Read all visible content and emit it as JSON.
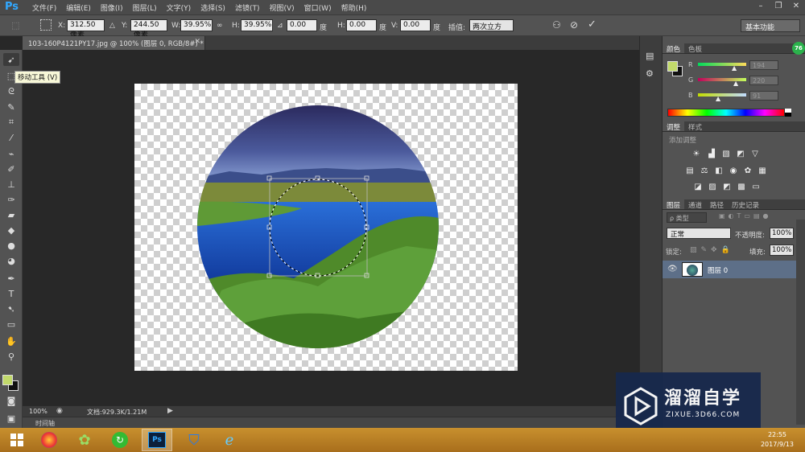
{
  "app": {
    "logo": "Ps"
  },
  "menu": [
    "文件(F)",
    "编辑(E)",
    "图像(I)",
    "图层(L)",
    "文字(Y)",
    "选择(S)",
    "滤镜(T)",
    "视图(V)",
    "窗口(W)",
    "帮助(H)"
  ],
  "options": {
    "x_label": "X:",
    "x_value": "312.50 像素",
    "y_label": "Y:",
    "y_value": "244.50 像素",
    "w_label": "W:",
    "w_value": "39.95%",
    "h_label": "H:",
    "h_value": "39.95%",
    "angle_value": "0.00",
    "angle_unit": "度",
    "hskew_label": "H:",
    "hskew_value": "0.00",
    "hskew_unit": "度",
    "vskew_label": "V:",
    "vskew_value": "0.00",
    "vskew_unit": "度",
    "interp_label": "插值:",
    "interp_value": "两次立方",
    "workspace": "基本功能"
  },
  "document": {
    "tab_title": "103-160P4121PY17.jpg @ 100% (图层 0, RGB/8#) *",
    "zoom": "100%",
    "docsize": "文档:929.3K/1.21M",
    "timeline": "时间轴"
  },
  "tooltip": "移动工具 (V)",
  "colors": {
    "foreground": "#c2da6b",
    "background": "#111111",
    "r": "194",
    "g": "220",
    "b": "91",
    "r_label": "R",
    "g_label": "G",
    "b_label": "B"
  },
  "color_panel": {
    "tabs": [
      "颜色",
      "色板"
    ]
  },
  "adjust_panel": {
    "tabs": [
      "调整",
      "样式"
    ],
    "subtitle": "添加调整"
  },
  "layers_panel": {
    "tabs": [
      "图层",
      "通道",
      "路径",
      "历史记录"
    ],
    "filter_label": "ρ 类型",
    "blend_mode": "正常",
    "opacity_label": "不透明度:",
    "opacity_value": "100%",
    "lock_label": "锁定:",
    "fill_label": "填充:",
    "fill_value": "100%",
    "layer_name": "图层 0"
  },
  "badge": "76",
  "taskbar": {
    "time": "22:55",
    "date": "2017/9/13"
  },
  "watermark": {
    "title": "溜溜自学",
    "url": "ZIXUE.3D66.COM"
  }
}
